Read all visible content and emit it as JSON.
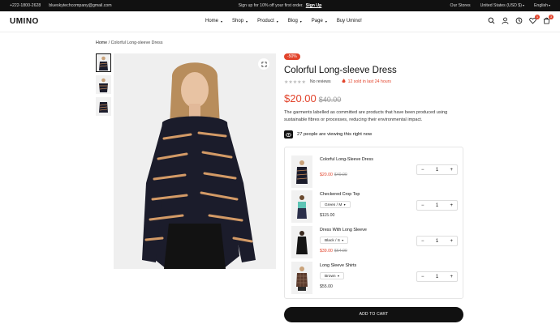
{
  "topbar": {
    "phone": "+222-1800-2628",
    "email": "blueskytechcompany@gmail.com",
    "promo": "Sign up for 10% off your first order.",
    "promo_link": "Sign Up",
    "stores": "Our Stores",
    "country": "United States (USD $)",
    "language": "English"
  },
  "header": {
    "logo": "UMINO",
    "nav": [
      "Home",
      "Shop",
      "Product",
      "Blog",
      "Page",
      "Buy Umino!"
    ],
    "wishlist_count": "1",
    "cart_count": "3"
  },
  "breadcrumb": {
    "home": "Home",
    "sep": "/",
    "current": "Colorful Long-sleeve Dress"
  },
  "product": {
    "sale_badge": "-50%",
    "title": "Colorful Long-sleeve Dress",
    "reviews": "No reviews",
    "stars": "★★★★★",
    "sold": "12 sold in last 24 hours",
    "price": "$20.00",
    "old_price": "$40.00",
    "description": "The garments labelled as committed are products that have been produced using sustainable fibres or processes, reducing their environmental impact.",
    "viewing": "27 people are viewing this right now"
  },
  "bundle": [
    {
      "name": "Colorful Long-Sleeve Dress",
      "variant": "",
      "price": "$20.00",
      "old_price": "$40.00",
      "qty": "1"
    },
    {
      "name": "Checkered Crop Top",
      "variant": "Green / M",
      "price": "$115.00",
      "old_price": "",
      "qty": "1"
    },
    {
      "name": "Dress With Long Sleeve",
      "variant": "Black / S",
      "price": "$39.00",
      "old_price": "$64.00",
      "qty": "1"
    },
    {
      "name": "Long Sleeve Shirts",
      "variant": "Brown",
      "price": "$55.00",
      "old_price": "",
      "qty": "1"
    }
  ],
  "qty_minus": "−",
  "qty_plus": "+",
  "add_to_cart": "ADD TO CART",
  "colors": {
    "accent": "#e2442c",
    "dark": "#111111"
  },
  "icons": [
    "search-icon",
    "user-icon",
    "compare-icon",
    "heart-icon",
    "cart-icon",
    "expand-icon",
    "eye-icon",
    "fire-icon"
  ]
}
